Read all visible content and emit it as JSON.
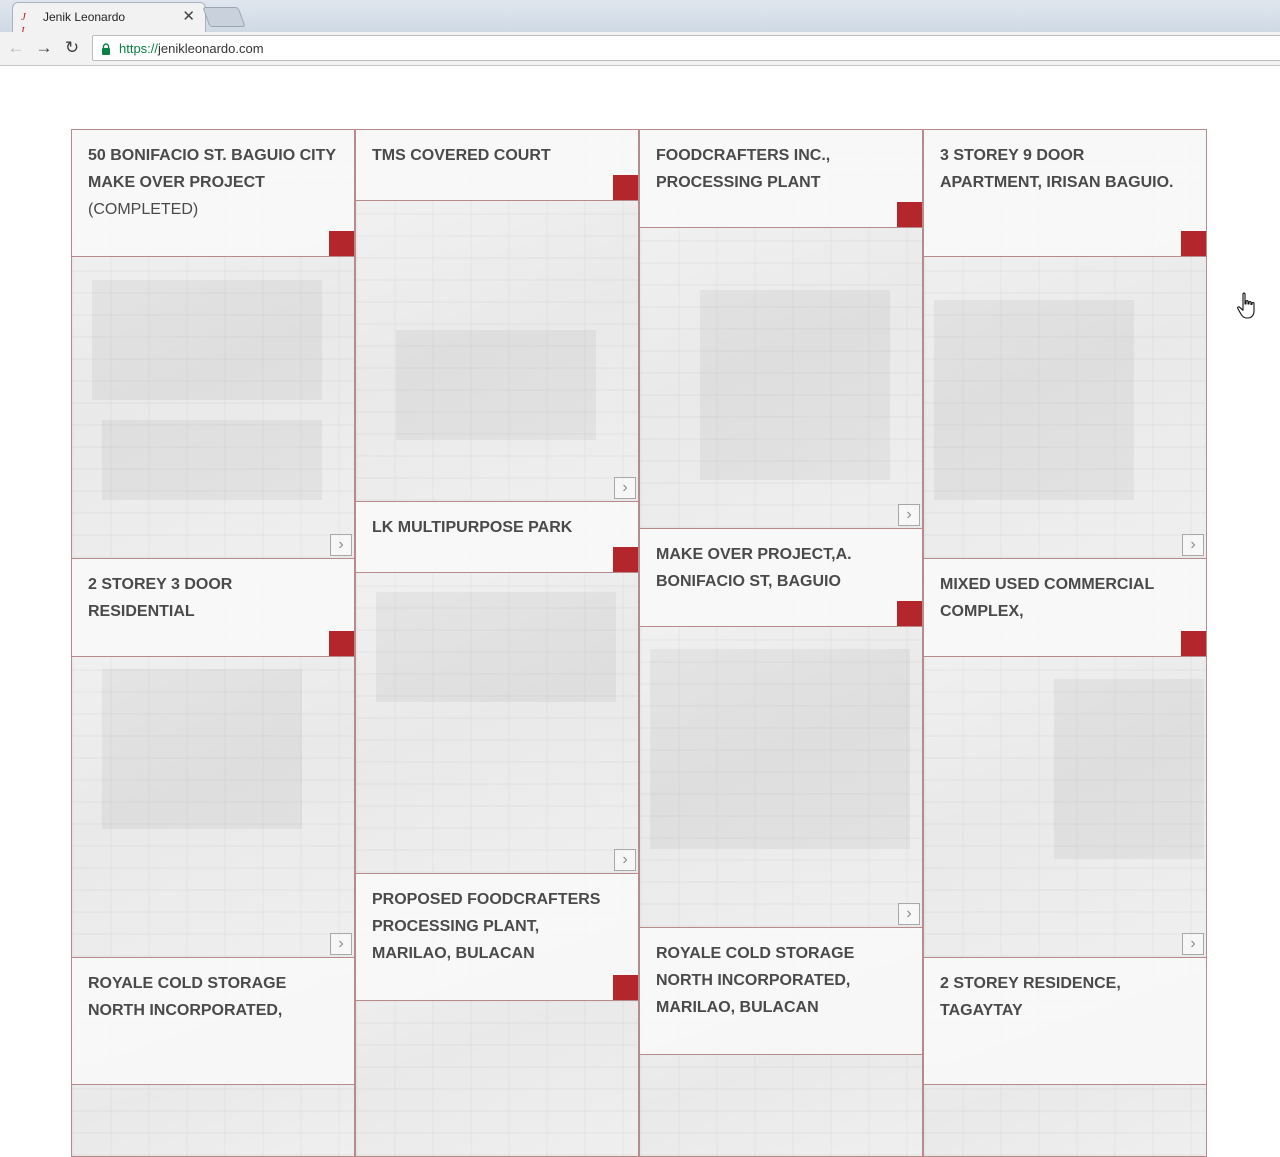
{
  "browser": {
    "tab_title": "Jenik Leonardo",
    "tab_favicon_text": "J L",
    "tab_close": "✕",
    "url_scheme": "https://",
    "url_host": "jenikleonardo.com",
    "nav": {
      "back": "←",
      "forward": "→",
      "reload": "↻"
    }
  },
  "projects": {
    "col1": [
      {
        "title": "50 Bonifacio St. Baguio City Make Over Project",
        "suffix": "(Completed)"
      },
      {
        "title": "2 Storey 3 Door Residential",
        "suffix": ""
      },
      {
        "title": "Royale Cold Storage North Incorporated,",
        "suffix": ""
      }
    ],
    "col2": [
      {
        "title": "TMS Covered Court",
        "suffix": ""
      },
      {
        "title": "LK Multipurpose Park",
        "suffix": ""
      },
      {
        "title": "Proposed Foodcrafters Processing Plant, Marilao, Bulacan",
        "suffix": ""
      }
    ],
    "col3": [
      {
        "title": "Foodcrafters Inc., Processing Plant",
        "suffix": ""
      },
      {
        "title": "Make Over Project,A. Bonifacio St, Baguio",
        "suffix": ""
      },
      {
        "title": "Royale Cold Storage North Incorporated, Marilao, Bulacan",
        "suffix": ""
      }
    ],
    "col4": [
      {
        "title": "3 Storey 9 Door Apartment, Irisan Baguio.",
        "suffix": ""
      },
      {
        "title": "Mixed Used Commercial Complex,",
        "suffix": ""
      },
      {
        "title": "2 Storey Residence, Tagaytay",
        "suffix": ""
      }
    ]
  },
  "arrow_glyph": "›",
  "colors": {
    "accent": "#b3262b",
    "border": "#b98a8c",
    "title_text": "#4a4a4a"
  }
}
